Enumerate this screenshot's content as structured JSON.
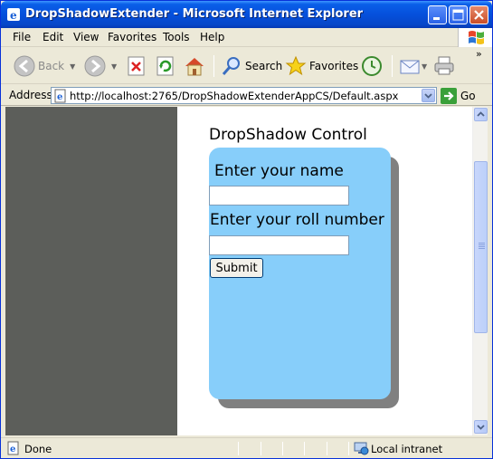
{
  "window": {
    "title": "DropShadowExtender - Microsoft Internet Explorer"
  },
  "menu": {
    "items": [
      "File",
      "Edit",
      "View",
      "Favorites",
      "Tools",
      "Help"
    ]
  },
  "toolbar": {
    "back_label": "Back",
    "search_label": "Search",
    "favorites_label": "Favorites"
  },
  "address": {
    "label": "Address",
    "url": "http://localhost:2765/DropShadowExtenderAppCS/Default.aspx",
    "go_label": "Go"
  },
  "page": {
    "heading": "DropShadow Control",
    "name_label": "Enter your name",
    "name_value": "",
    "roll_label": "Enter your roll number",
    "roll_value": "",
    "submit_label": "Submit",
    "panel_color": "#87cefa",
    "shadow_color": "#808080"
  },
  "status": {
    "text": "Done",
    "zone": "Local intranet"
  },
  "icons": [
    "ie-icon",
    "minimize-icon",
    "maximize-icon",
    "close-icon",
    "windows-logo-icon",
    "back-arrow-icon",
    "forward-arrow-icon",
    "stop-icon",
    "refresh-icon",
    "home-icon",
    "search-icon",
    "favorites-star-icon",
    "history-icon",
    "mail-icon",
    "print-icon",
    "page-icon",
    "go-arrow-icon",
    "zone-icon"
  ]
}
